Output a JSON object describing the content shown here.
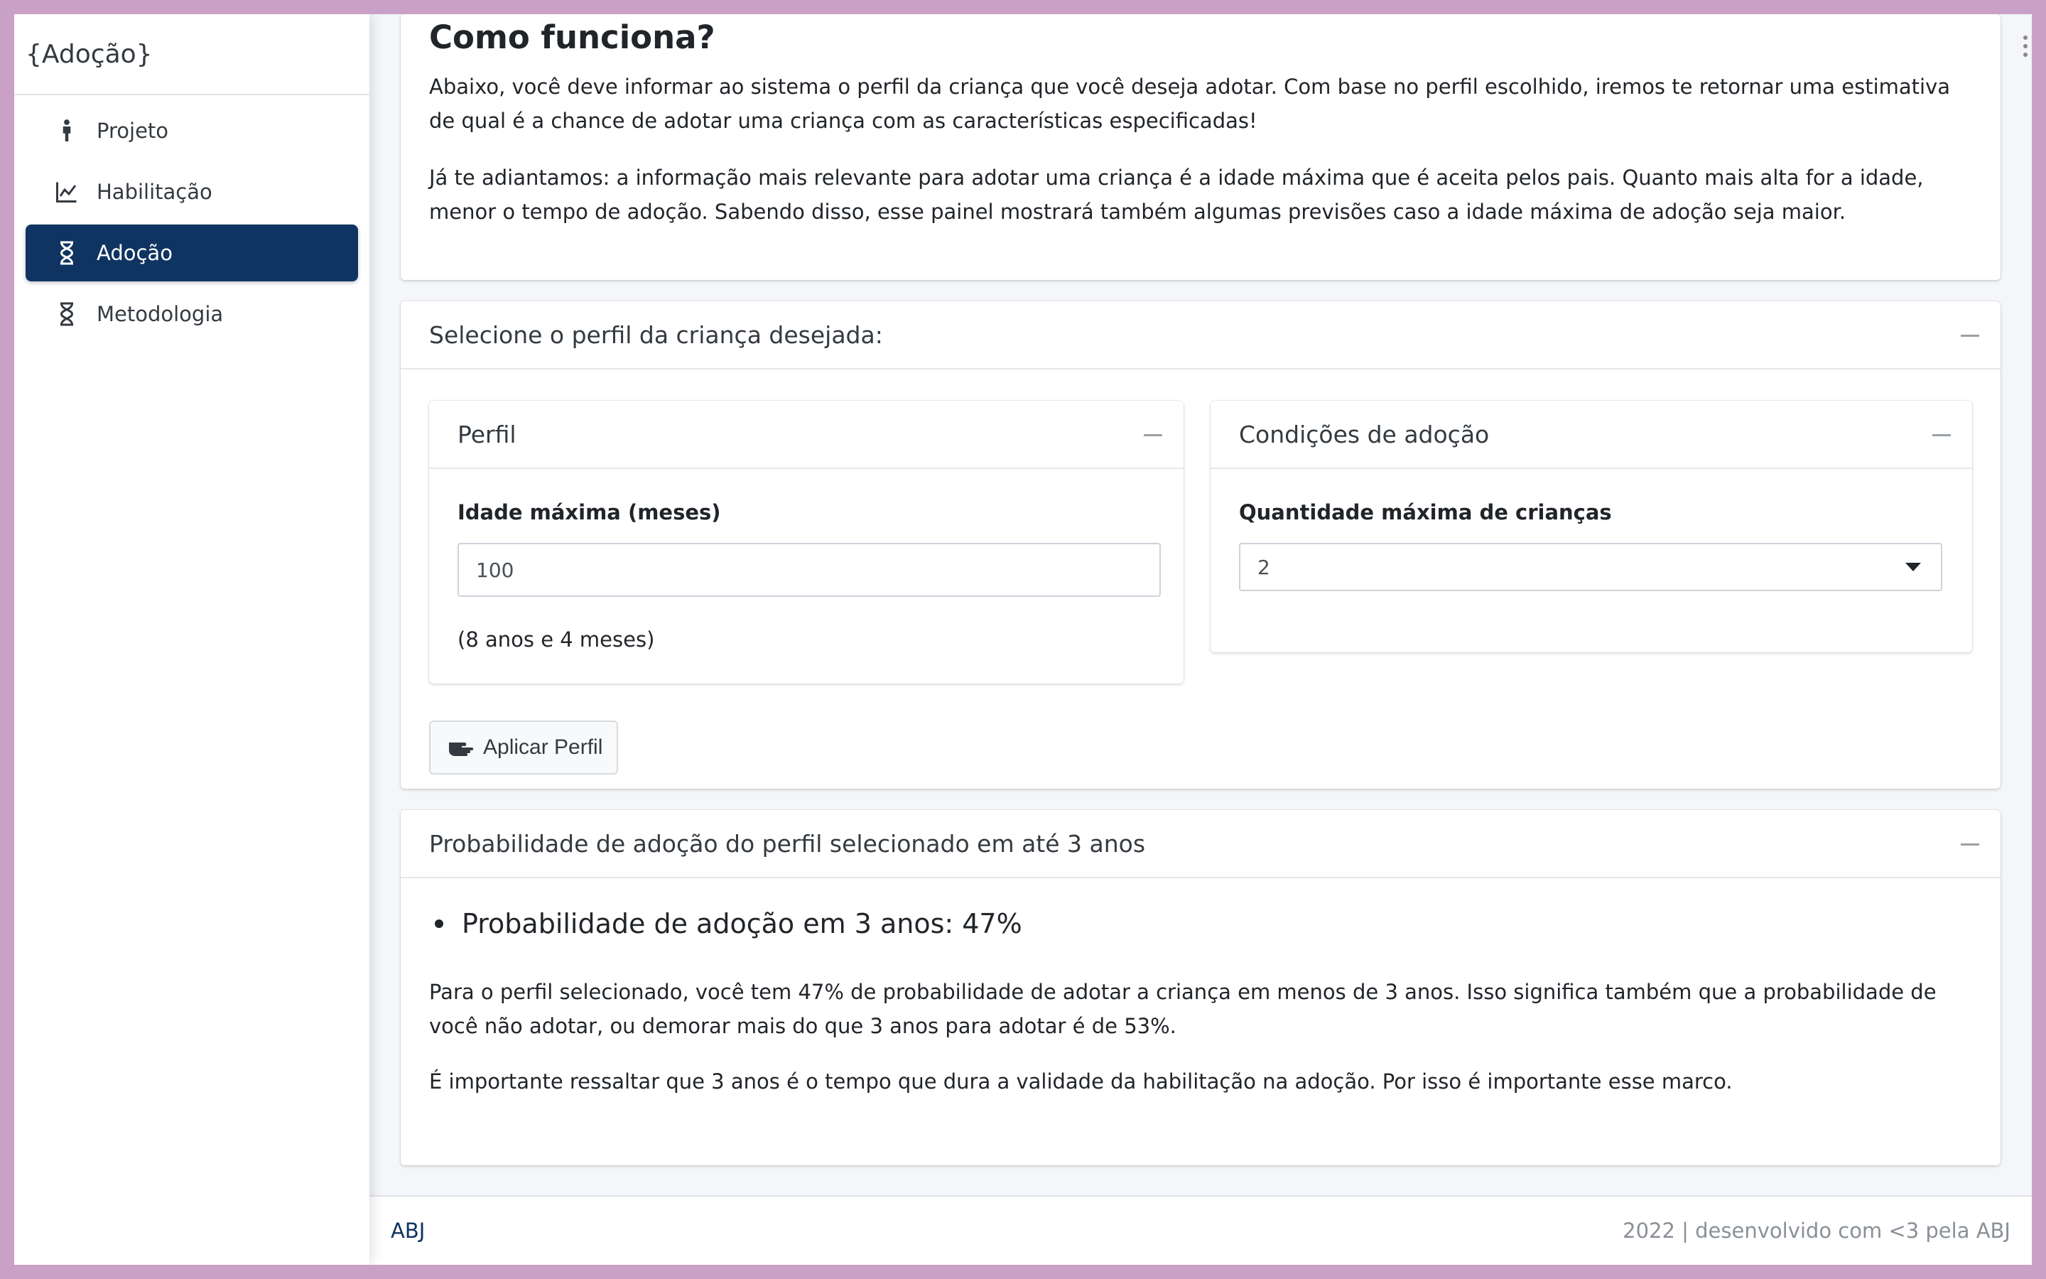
{
  "sidebar": {
    "brand": "{Adoção}",
    "items": [
      {
        "label": "Projeto",
        "icon": "child-icon",
        "active": false
      },
      {
        "label": "Habilitação",
        "icon": "line-chart-icon",
        "active": false
      },
      {
        "label": "Adoção",
        "icon": "hourglass-icon",
        "active": true
      },
      {
        "label": "Metodologia",
        "icon": "hourglass-icon",
        "active": false
      }
    ]
  },
  "intro": {
    "title": "Como funciona?",
    "p1": "Abaixo, você deve informar ao sistema o perfil da criança que você deseja adotar. Com base no perfil escolhido, iremos te retornar uma estimativa de qual é a chance de adotar uma criança com as características especificadas!",
    "p2": "Já te adiantamos: a informação mais relevante para adotar uma criança é a idade máxima que é aceita pelos pais. Quanto mais alta for a idade, menor o tempo de adoção. Sabendo disso, esse painel mostrará também algumas previsões caso a idade máxima de adoção seja maior."
  },
  "profile_section": {
    "title": "Selecione o perfil da criança desejada:",
    "perfil": {
      "title": "Perfil",
      "age_label": "Idade máxima (meses)",
      "age_value": "100",
      "age_hint": "(8 anos e 4 meses)"
    },
    "conditions": {
      "title": "Condições de adoção",
      "qty_label": "Quantidade máxima de crianças",
      "qty_value": "2"
    },
    "apply_button": "Aplicar Perfil"
  },
  "result": {
    "title": "Probabilidade de adoção do perfil selecionado em até 3 anos",
    "bullet": "Probabilidade de adoção em 3 anos: 47%",
    "p1": "Para o perfil selecionado, você tem 47% de probabilidade de adotar a criança em menos de 3 anos. Isso significa também que a probabilidade de você não adotar, ou demorar mais do que 3 anos para adotar é de 53%.",
    "p2": "É importante ressaltar que 3 anos é o tempo que dura a validade da habilitação na adoção. Por isso é importante esse marco."
  },
  "footer": {
    "left": "ABJ",
    "right": "2022 | desenvolvido com <3 pela ABJ"
  },
  "colors": {
    "accent": "#0f3461",
    "background": "#f4f6f9",
    "frame": "#c9a1c6"
  }
}
